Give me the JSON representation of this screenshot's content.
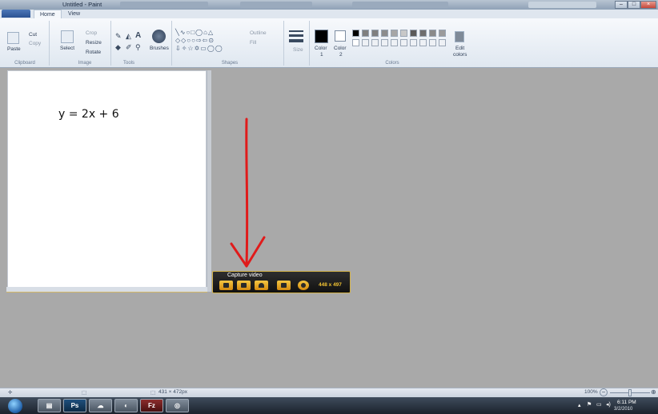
{
  "window": {
    "title": "Untitled - Paint"
  },
  "ribbon": {
    "tabs": [
      "Home",
      "View"
    ],
    "clipboard": {
      "paste": "Paste",
      "cut": "Cut",
      "copy": "Copy",
      "label": "Clipboard"
    },
    "image": {
      "select": "Select",
      "crop": "Crop",
      "resize": "Resize",
      "rotate": "Rotate",
      "label": "Image"
    },
    "tools": {
      "label": "Tools"
    },
    "brushes": "Brushes",
    "shapes": {
      "outline": "Outline",
      "fill": "Fill",
      "label": "Shapes"
    },
    "size": "Size",
    "color1": {
      "line1": "Color",
      "line2": "1"
    },
    "color2": {
      "line1": "Color",
      "line2": "2"
    },
    "colors": {
      "label": "Colors",
      "edit_line1": "Edit",
      "edit_line2": "colors"
    }
  },
  "canvas": {
    "text": "y = 2x + 6"
  },
  "capture": {
    "title": "Capture video",
    "size": "448 x 497"
  },
  "statusbar": {
    "size": "431 × 472px",
    "zoom": "100%"
  },
  "taskbar": {
    "ps": "Ps",
    "fz": "Fz",
    "time": "6:11 PM",
    "date": "3/2/2010"
  },
  "colors": {
    "arrow": "#e01b1b",
    "palette": [
      "#000000",
      "#7f7f7f",
      "#7f7f7f",
      "#8c8c8c",
      "#a6a6a6",
      "#c8c8c8",
      "#5a5a5a",
      "#6e6e6e",
      "#8a8a8a",
      "#9b9b9b"
    ]
  }
}
